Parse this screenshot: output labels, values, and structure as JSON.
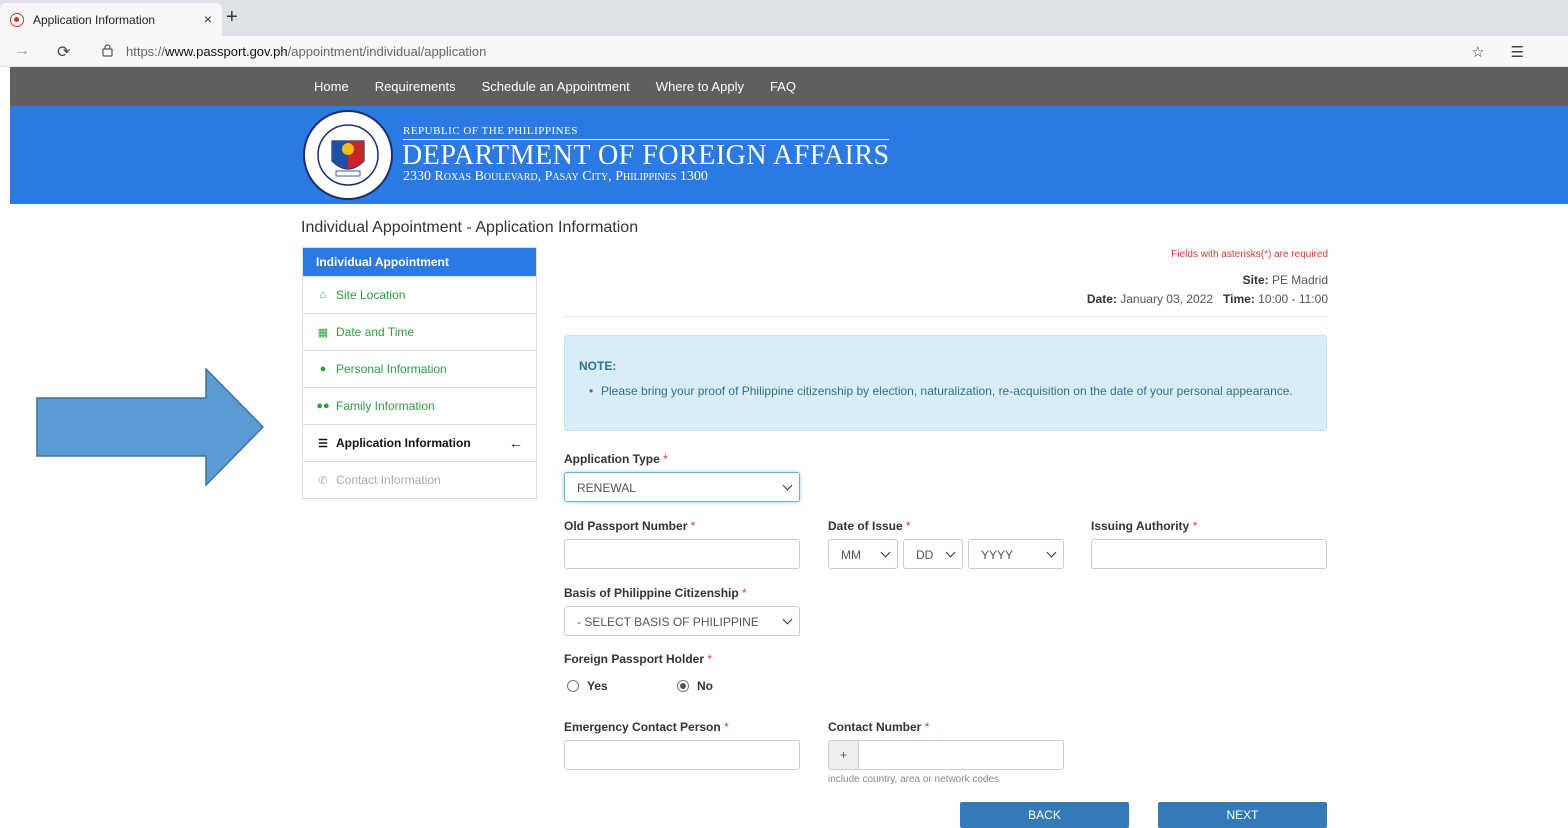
{
  "browser": {
    "tab_title": "Application Information",
    "tab_close": "×",
    "new_tab": "+",
    "url_prefix": "https://",
    "url_domain": "www.passport.gov.ph",
    "url_path": "/appointment/individual/application"
  },
  "site_nav": [
    "Home",
    "Requirements",
    "Schedule an Appointment",
    "Where to Apply",
    "FAQ"
  ],
  "banner": {
    "republic": "REPUBLIC OF THE PHILIPPINES",
    "department": "DEPARTMENT OF FOREIGN AFFAIRS",
    "address": "2330 Roxas Boulevard, Pasay City, Philippines 1300"
  },
  "page_title": "Individual Appointment - Application Information",
  "sidebar": {
    "header": "Individual Appointment",
    "items": [
      {
        "label": "Site Location",
        "icon": "home-icon"
      },
      {
        "label": "Date and Time",
        "icon": "calendar-icon"
      },
      {
        "label": "Personal Information",
        "icon": "user-icon"
      },
      {
        "label": "Family Information",
        "icon": "users-icon"
      },
      {
        "label": "Application Information",
        "icon": "list-icon",
        "active": true,
        "back_arrow": "←"
      },
      {
        "label": "Contact Information",
        "icon": "phone-icon",
        "disabled": true
      }
    ]
  },
  "info": {
    "required_note": "Fields with asterisks(*) are required",
    "site_label": "Site:",
    "site_value": "PE Madrid",
    "date_label": "Date:",
    "date_value": "January 03, 2022",
    "time_label": "Time:",
    "time_value": "10:00 - 11:00"
  },
  "note": {
    "title": "NOTE:",
    "text": "Please bring your proof of Philippine citizenship by election, naturalization, re-acquisition on the date of your personal appearance."
  },
  "form": {
    "asterisk": "*",
    "application_type_label": "Application Type",
    "application_type_value": "RENEWAL",
    "old_passport_label": "Old Passport Number",
    "date_of_issue_label": "Date of Issue",
    "month_value": "MM",
    "day_value": "DD",
    "year_value": "YYYY",
    "issuing_authority_label": "Issuing Authority",
    "citizenship_label": "Basis of Philippine Citizenship",
    "citizenship_value": "- SELECT BASIS OF PHILIPPINE",
    "foreign_passport_label": "Foreign Passport Holder",
    "yes_label": "Yes",
    "no_label": "No",
    "foreign_passport_selected": "No",
    "emergency_contact_label": "Emergency Contact Person",
    "contact_number_label": "Contact Number",
    "contact_prefix": "+",
    "contact_hint": "include country, area or network codes"
  },
  "buttons": {
    "back": "BACK",
    "next": "NEXT"
  },
  "colors": {
    "brand_blue": "#2b7ae4",
    "nav_gray": "#5f5f5f",
    "button_blue": "#337ab7",
    "link_green": "#2e9e3e",
    "required_red": "#d43f3a",
    "arrow_blue": "#5b9bd5"
  }
}
